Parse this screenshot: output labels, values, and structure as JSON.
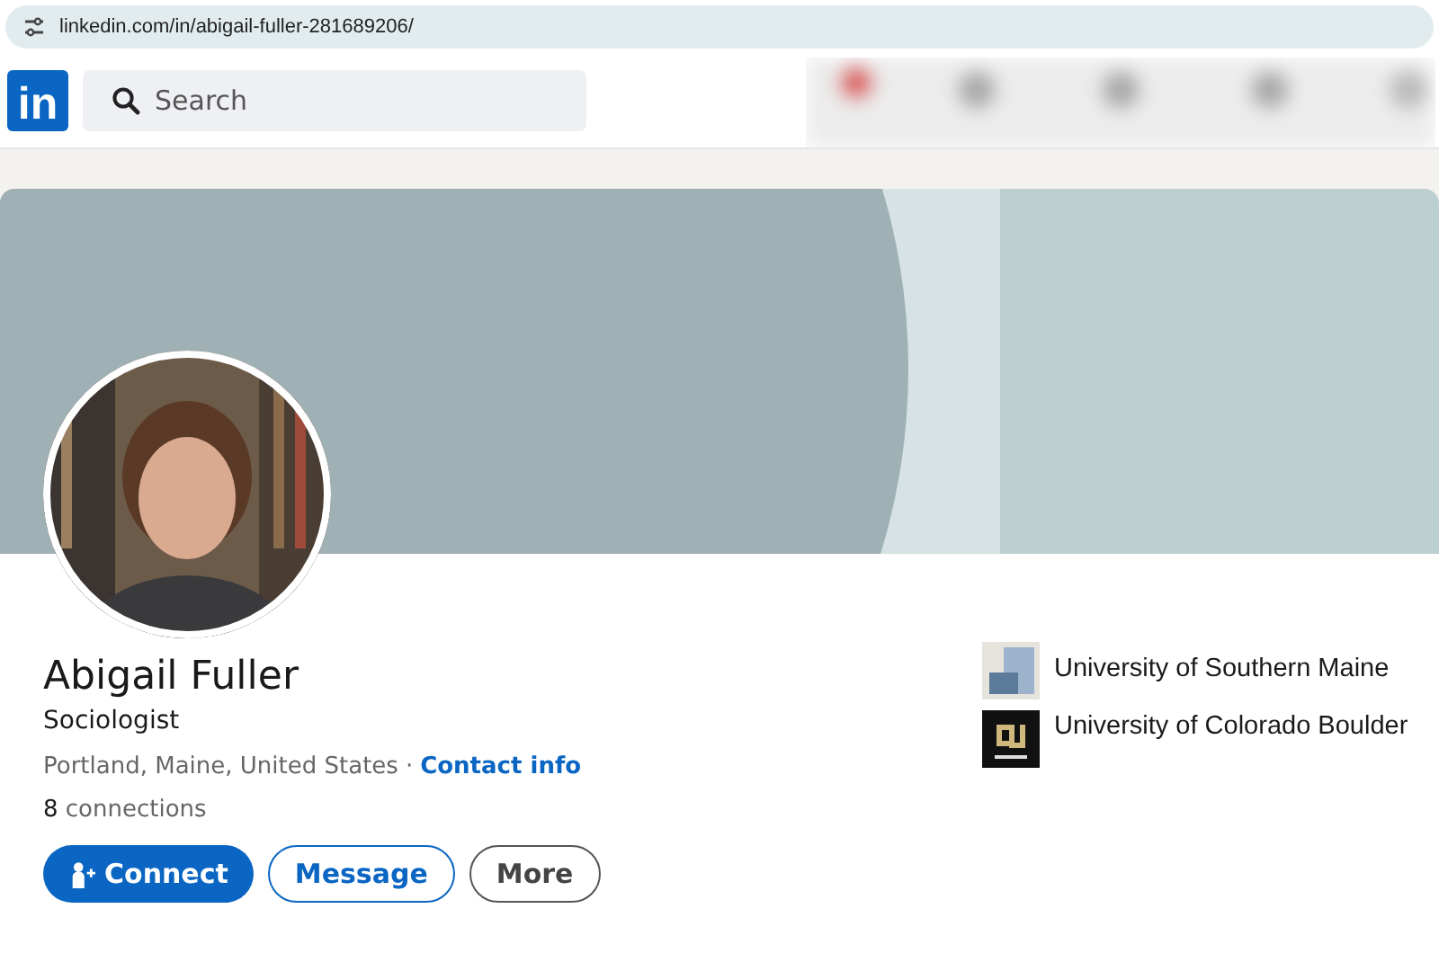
{
  "browser": {
    "url": "linkedin.com/in/abigail-fuller-281689206/"
  },
  "navbar": {
    "logo": "in",
    "search": {
      "placeholder": "Search"
    }
  },
  "profile": {
    "name": "Abigail Fuller",
    "headline": "Sociologist",
    "location": "Portland, Maine, United States",
    "separator": "·",
    "contact_link": "Contact info",
    "connections_count": "8",
    "connections_label": "connections",
    "buttons": [
      {
        "label": "Connect",
        "kind": "primary"
      },
      {
        "label": "Message",
        "kind": "outline"
      },
      {
        "label": "More",
        "kind": "plain"
      }
    ],
    "education": [
      {
        "name": "University of Southern Maine",
        "kind": "blocks"
      },
      {
        "name": "University of Colorado Boulder",
        "kind": "dark"
      }
    ]
  }
}
